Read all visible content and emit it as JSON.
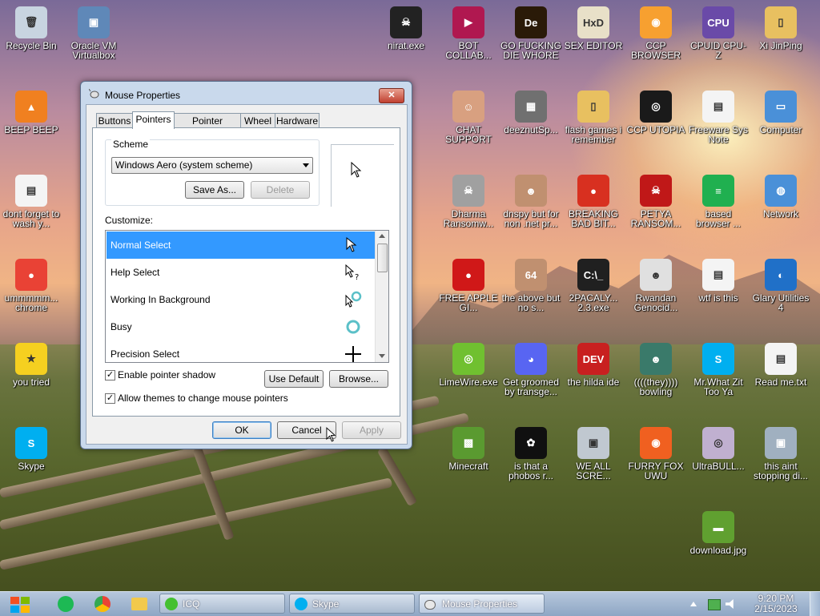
{
  "desktop": {
    "icons": [
      {
        "label": "Recycle Bin",
        "color": "#c8d4e0",
        "glyph": "🗑"
      },
      {
        "label": "Oracle VM Virtualbox",
        "color": "#5f88b8",
        "glyph": "▣"
      },
      {
        "label": "BEEP BEEP",
        "color": "#f08020",
        "glyph": "▲"
      },
      {
        "label": "dont forget to wash y...",
        "color": "#f4f4f4",
        "glyph": "▤"
      },
      {
        "label": "ummmmm... chrome",
        "color": "#e94235",
        "glyph": "●"
      },
      {
        "label": "you tried",
        "color": "#f5d020",
        "glyph": "★"
      },
      {
        "label": "Skype",
        "color": "#00aff0",
        "glyph": "S"
      },
      {
        "label": "nirat.exe",
        "color": "#222222",
        "glyph": "☠"
      },
      {
        "label": "BOT COLLAB...",
        "color": "#b01850",
        "glyph": "▶"
      },
      {
        "label": "GO FUCKING DIE WHORE",
        "color": "#2a1a08",
        "glyph": "De"
      },
      {
        "label": "SEX EDITOR",
        "color": "#e8e0c8",
        "glyph": "HxD"
      },
      {
        "label": "CCP BROWSER",
        "color": "#f7a030",
        "glyph": "◉"
      },
      {
        "label": "CPUID CPU-Z",
        "color": "#6a4aa8",
        "glyph": "CPU"
      },
      {
        "label": "Xi JinPing",
        "color": "#e8c060",
        "glyph": "▯"
      },
      {
        "label": "CHAT SUPPORT",
        "color": "#d8a080",
        "glyph": "☺"
      },
      {
        "label": "deeznutSp...",
        "color": "#707070",
        "glyph": "▦"
      },
      {
        "label": "flash games i remember",
        "color": "#e8c060",
        "glyph": "▯"
      },
      {
        "label": "CCP UTOPIA",
        "color": "#1a1a1a",
        "glyph": "◎"
      },
      {
        "label": "Freeware Sys Note",
        "color": "#f4f4f4",
        "glyph": "▤"
      },
      {
        "label": "Computer",
        "color": "#4a90d8",
        "glyph": "▭"
      },
      {
        "label": "Dharma Ransomw...",
        "color": "#a0a0a0",
        "glyph": "☠"
      },
      {
        "label": "dnspy but for non .net pr...",
        "color": "#c09070",
        "glyph": "☻"
      },
      {
        "label": "BREAKING BAD BIT...",
        "color": "#d83020",
        "glyph": "●"
      },
      {
        "label": "PETYA RANSOM...",
        "color": "#c01818",
        "glyph": "☠"
      },
      {
        "label": "based browser ...",
        "color": "#20b050",
        "glyph": "≡"
      },
      {
        "label": "Network",
        "color": "#4a90d8",
        "glyph": "◍"
      },
      {
        "label": "FREE APPLE GI...",
        "color": "#d01818",
        "glyph": "●"
      },
      {
        "label": "the above but no s...",
        "color": "#c09070",
        "glyph": "64"
      },
      {
        "label": "2PACALY... 2.3.exe",
        "color": "#202020",
        "glyph": "C:\\_"
      },
      {
        "label": "Rwandan Genocid...",
        "color": "#e0e0e0",
        "glyph": "☻"
      },
      {
        "label": "wtf is this",
        "color": "#f4f4f4",
        "glyph": "▤"
      },
      {
        "label": "Glary Utilities 4",
        "color": "#2070c8",
        "glyph": "◐"
      },
      {
        "label": "LimeWire.exe",
        "color": "#70c030",
        "glyph": "◎"
      },
      {
        "label": "Get groomed by transge...",
        "color": "#5865f2",
        "glyph": "◕"
      },
      {
        "label": "the hilda ide",
        "color": "#c82020",
        "glyph": "DEV"
      },
      {
        "label": "((((they)))) bowling",
        "color": "#3a7a6a",
        "glyph": "☻"
      },
      {
        "label": "Mr.What Zit Too Ya",
        "color": "#00aff0",
        "glyph": "S"
      },
      {
        "label": "Read me.txt",
        "color": "#f4f4f4",
        "glyph": "▤"
      },
      {
        "label": "Minecraft",
        "color": "#5a9a30",
        "glyph": "▩"
      },
      {
        "label": "is that a phobos r...",
        "color": "#101010",
        "glyph": "✿"
      },
      {
        "label": "WE ALL SCRE...",
        "color": "#c0c8d0",
        "glyph": "▣"
      },
      {
        "label": "FURRY FOX UWU",
        "color": "#f06020",
        "glyph": "◉"
      },
      {
        "label": "UltraBULL...",
        "color": "#c0b0d0",
        "glyph": "◎"
      },
      {
        "label": "this aint stopping di...",
        "color": "#a0b0c0",
        "glyph": "▣"
      },
      {
        "label": "download.jpg",
        "color": "#60a030",
        "glyph": "▬"
      }
    ]
  },
  "window": {
    "title": "Mouse Properties",
    "close_label": "✕",
    "tabs": [
      "Buttons",
      "Pointers",
      "Pointer Options",
      "Wheel",
      "Hardware"
    ],
    "active_tab": "Pointers",
    "scheme_label": "Scheme",
    "scheme_value": "Windows Aero (system scheme)",
    "save_as_label": "Save As...",
    "delete_label": "Delete",
    "customize_label": "Customize:",
    "pointers": [
      {
        "name": "Normal Select",
        "selected": true
      },
      {
        "name": "Help Select",
        "selected": false
      },
      {
        "name": "Working In Background",
        "selected": false
      },
      {
        "name": "Busy",
        "selected": false
      },
      {
        "name": "Precision Select",
        "selected": false
      }
    ],
    "shadow_label": "Enable pointer shadow",
    "shadow_checked": "✓",
    "themes_label": "Allow themes to change mouse pointers",
    "themes_checked": "✓",
    "use_default_label": "Use Default",
    "browse_label": "Browse...",
    "ok_label": "OK",
    "cancel_label": "Cancel",
    "apply_label": "Apply"
  },
  "taskbar": {
    "items": [
      {
        "label": "ICQ",
        "color": "#44c030"
      },
      {
        "label": "Skype",
        "color": "#00aff0"
      },
      {
        "label": "Mouse Properties",
        "color": "#ffffff"
      }
    ],
    "time": "9:20 PM",
    "date": "2/15/2023"
  }
}
